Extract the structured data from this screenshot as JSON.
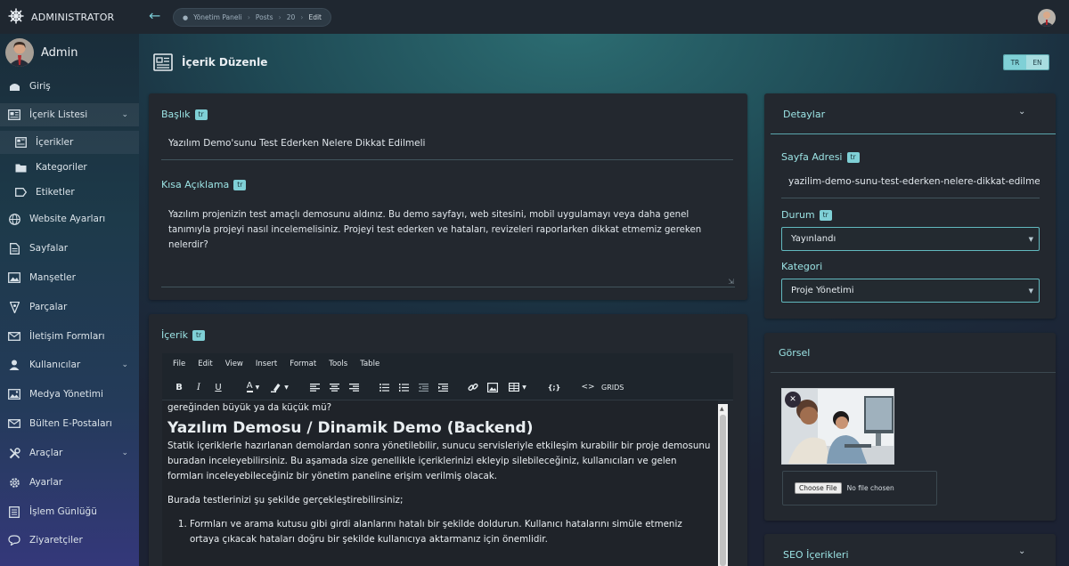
{
  "brand": {
    "name": "ADMINISTRATOR"
  },
  "breadcrumb": [
    "Yönetim Paneli",
    "Posts",
    "20",
    "Edit"
  ],
  "sidebar": {
    "user_name": "Admin",
    "items": [
      {
        "label": "Giriş"
      },
      {
        "label": "İçerik Listesi"
      },
      {
        "label": "İçerikler"
      },
      {
        "label": "Kategoriler"
      },
      {
        "label": "Etiketler"
      },
      {
        "label": "Website Ayarları"
      },
      {
        "label": "Sayfalar"
      },
      {
        "label": "Manşetler"
      },
      {
        "label": "Parçalar"
      },
      {
        "label": "İletişim Formları"
      },
      {
        "label": "Kullanıcılar"
      },
      {
        "label": "Medya Yönetimi"
      },
      {
        "label": "Bülten E-Postaları"
      },
      {
        "label": "Araçlar"
      },
      {
        "label": "Ayarlar"
      },
      {
        "label": "İşlem Günlüğü"
      },
      {
        "label": "Ziyaretçiler"
      }
    ]
  },
  "page": {
    "title": "İçerik Düzenle"
  },
  "lang": {
    "tr": "TR",
    "en": "EN"
  },
  "form": {
    "title_label": "Başlık",
    "title_value": "Yazılım Demo'sunu Test Ederken Nelere Dikkat Edilmeli",
    "summary_label": "Kısa Açıklama",
    "summary_value": "Yazılım projenizin test amaçlı demosunu aldınız. Bu demo sayfayı, web sitesini, mobil uygulamayı veya daha genel tanımıyla projeyi nasıl incelemelisiniz. Projeyi test ederken ve hataları, revizeleri raporlarken dikkat etmemiz gereken nelerdir?",
    "content_label": "İçerik",
    "lang_tag": "tr"
  },
  "editor": {
    "menu": [
      "File",
      "Edit",
      "View",
      "Insert",
      "Format",
      "Tools",
      "Table"
    ],
    "grids_label": "GRIDS",
    "content": {
      "line1": "gereğinden büyük ya da küçük mü?",
      "heading": "Yazılım Demosu / Dinamik Demo (Backend)",
      "para1": "Statik içeriklerle hazırlanan demolardan sonra yönetilebilir, sunucu servisleriyle etkileşim kurabilir bir proje demosunu buradan inceleyebilirsiniz. Bu aşamada size genellikle içeriklerinizi ekleyip silebileceğiniz, kullanıcıları ve gelen formları inceleyebileceğiniz bir yönetim paneline erişim verilmiş olacak.",
      "para2": "Burada testlerinizi şu şekilde gerçekleştirebilirsiniz;",
      "list1": "Formları ve arama kutusu gibi girdi alanlarını hatalı bir şekilde doldurun. Kullanıcı hatalarını simüle etmeniz ortaya çıkacak hataları doğru bir şekilde kullanıcıya aktarmanız için önemlidir."
    }
  },
  "details": {
    "title": "Detaylar",
    "slug_label": "Sayfa Adresi",
    "slug_value": "yazilim-demo-sunu-test-ederken-nelere-dikkat-edilmeli",
    "status_label": "Durum",
    "status_value": "Yayınlandı",
    "category_label": "Kategori",
    "category_value": "Proje Yönetimi"
  },
  "image": {
    "title": "Görsel",
    "choose_file": "Choose File",
    "no_file": "No file chosen"
  },
  "seo": {
    "title": "SEO İçerikleri"
  },
  "colors": {
    "accent": "#7fd0d6",
    "label": "#9be3e4",
    "card": "#23282f"
  }
}
